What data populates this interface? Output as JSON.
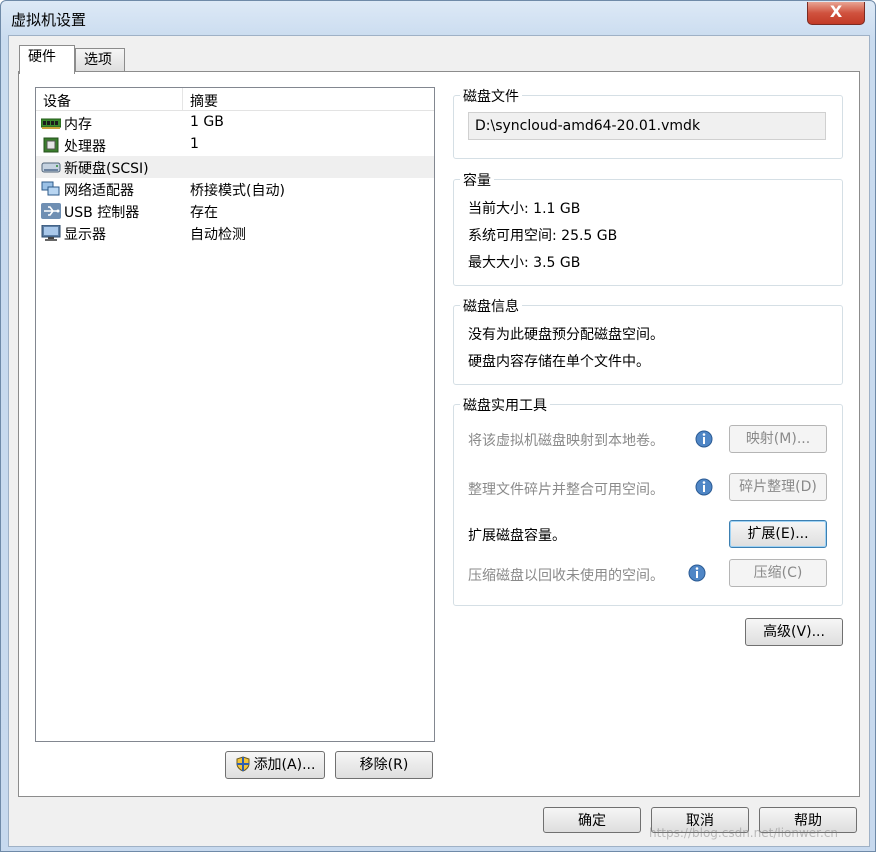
{
  "window": {
    "title": "虚拟机设置",
    "close_label": "X"
  },
  "tabs": [
    {
      "label": "硬件",
      "active": true
    },
    {
      "label": "选项",
      "active": false
    }
  ],
  "device_list": {
    "columns": [
      "设备",
      "摘要"
    ],
    "rows": [
      {
        "name": "内存",
        "summary": "1 GB",
        "icon": "memory-icon"
      },
      {
        "name": "处理器",
        "summary": "1",
        "icon": "processor-icon"
      },
      {
        "name": "新硬盘(SCSI)",
        "summary": "",
        "icon": "harddisk-icon",
        "selected": true
      },
      {
        "name": "网络适配器",
        "summary": "桥接模式(自动)",
        "icon": "network-icon"
      },
      {
        "name": "USB 控制器",
        "summary": "存在",
        "icon": "usb-icon"
      },
      {
        "name": "显示器",
        "summary": "自动检测",
        "icon": "display-icon"
      }
    ],
    "add_button": "添加(A)...",
    "remove_button": "移除(R)"
  },
  "disk_file": {
    "label": "磁盘文件",
    "path": "D:\\syncloud-amd64-20.01.vmdk"
  },
  "capacity": {
    "label": "容量",
    "current_size": "当前大小: 1.1 GB",
    "available_space": "系统可用空间: 25.5 GB",
    "max_size": "最大大小: 3.5 GB"
  },
  "disk_info": {
    "label": "磁盘信息",
    "line1": "没有为此硬盘预分配磁盘空间。",
    "line2": "硬盘内容存储在单个文件中。"
  },
  "disk_tools": {
    "label": "磁盘实用工具",
    "map_text": "将该虚拟机磁盘映射到本地卷。",
    "map_button": "映射(M)...",
    "defrag_text": "整理文件碎片并整合可用空间。",
    "defrag_button": "碎片整理(D)",
    "expand_text": "扩展磁盘容量。",
    "expand_button": "扩展(E)...",
    "compact_text": "压缩磁盘以回收未使用的空间。",
    "compact_button": "压缩(C)"
  },
  "advanced_button": "高级(V)...",
  "footer": {
    "ok": "确定",
    "cancel": "取消",
    "help": "帮助"
  },
  "watermark": "https://blog.csdn.net/lionwer.cn"
}
